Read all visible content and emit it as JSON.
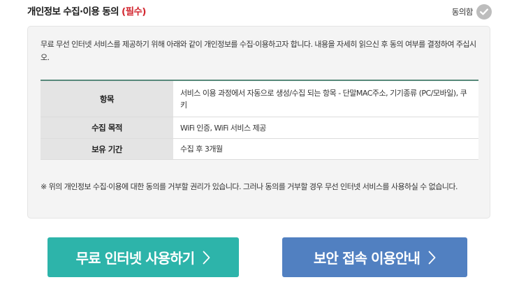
{
  "header": {
    "title": "개인정보 수집·이용 동의",
    "required": "(필수)",
    "agree_label": "동의함"
  },
  "intro": "무료 무선 인터넷 서비스를 제공하기 위해 아래와 같이 개인정보를 수집·이용하고자 합니다. 내용을 자세히 읽으신 후 동의 여부를 결정하여 주십시오.",
  "table": {
    "rows": [
      {
        "label": "항목",
        "value": "서비스 이용 과정에서 자동으로 생성/수집 되는 항목 - 단말MAC주소, 기기종류 (PC/모바일), 쿠키"
      },
      {
        "label": "수집 목적",
        "value": "WiFi 인증, WiFi 서비스 제공"
      },
      {
        "label": "보유 기간",
        "value": "수집 후 3개월"
      }
    ]
  },
  "notice": "※ 위의 개인정보 수집·이용에 대한 동의를 거부할 권리가 있습니다. 그러나 동의를 거부할 경우 무선 인터넷 서비스를 사용하실 수 없습니다.",
  "buttons": {
    "free_internet": "무료 인터넷 사용하기",
    "secure_guide": "보안 접속 이용안내"
  },
  "icons": {
    "agree": "check-icon",
    "button_arrow": "chevron-right-icon"
  },
  "colors": {
    "required": "#d2262f",
    "free_button": "#2db4aa",
    "secure_button": "#5180c1",
    "table_accent": "#57897a",
    "check_circle": "#bdbdbd"
  }
}
